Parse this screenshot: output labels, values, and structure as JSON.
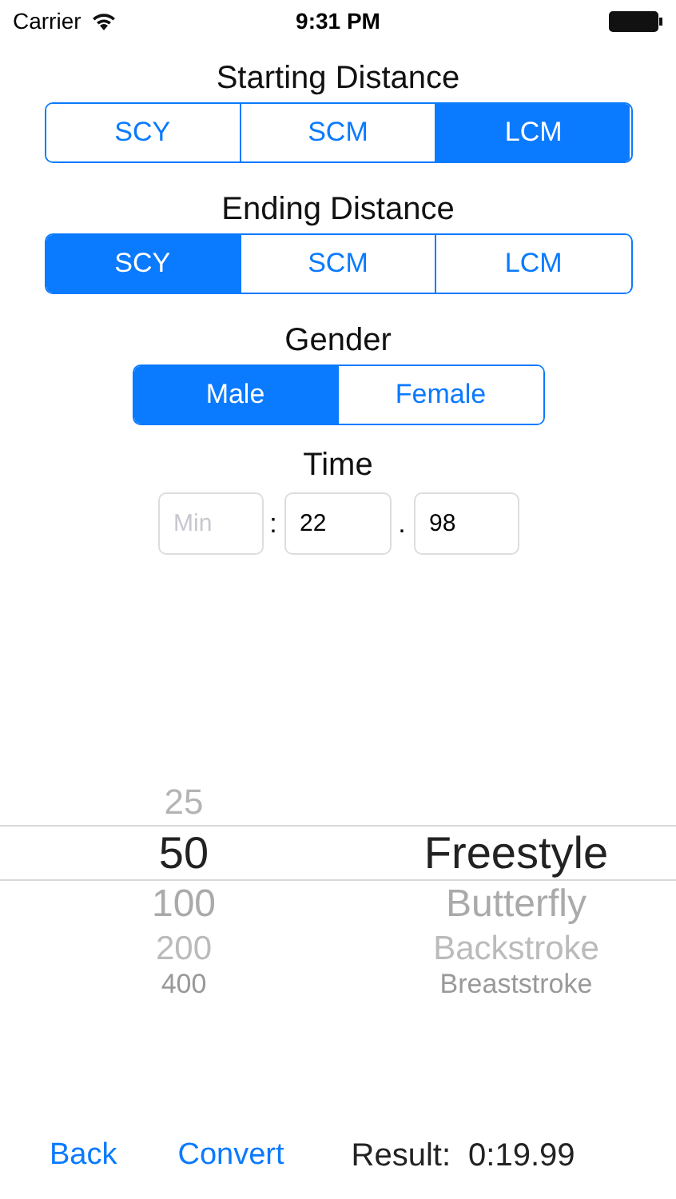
{
  "status_bar": {
    "carrier": "Carrier",
    "time": "9:31 PM"
  },
  "sections": [
    {
      "title": "Starting Distance",
      "segments": [
        {
          "label": "SCY",
          "selected": false
        },
        {
          "label": "SCM",
          "selected": false
        },
        {
          "label": "LCM",
          "selected": true
        }
      ]
    },
    {
      "title": "Ending Distance",
      "segments": [
        {
          "label": "SCY",
          "selected": true
        },
        {
          "label": "SCM",
          "selected": false
        },
        {
          "label": "LCM",
          "selected": false
        }
      ]
    },
    {
      "title": "Gender",
      "segments": [
        {
          "label": "Male",
          "selected": true
        },
        {
          "label": "Female",
          "selected": false
        }
      ]
    }
  ],
  "time": {
    "title": "Time",
    "minutes": {
      "placeholder": "Min"
    },
    "separator_1": ":",
    "seconds": {
      "value": "22"
    },
    "separator_2": ".",
    "hundredths": {
      "value": "98"
    }
  },
  "picker": {
    "distances": [
      {
        "label": "25",
        "selected": false
      },
      {
        "label": "50",
        "selected": true
      },
      {
        "label": "100",
        "selected": false
      },
      {
        "label": "200",
        "selected": false
      },
      {
        "label": "400",
        "selected": false
      }
    ],
    "strokes": [
      {
        "label": "Freestyle",
        "selected": true
      },
      {
        "label": "Butterfly",
        "selected": false
      },
      {
        "label": "Backstroke",
        "selected": false
      },
      {
        "label": "Breaststroke",
        "selected": false
      }
    ]
  },
  "toolbar": {
    "back": "Back",
    "convert": "Convert",
    "result_label": "Result:",
    "result_value": "0:19.99"
  }
}
